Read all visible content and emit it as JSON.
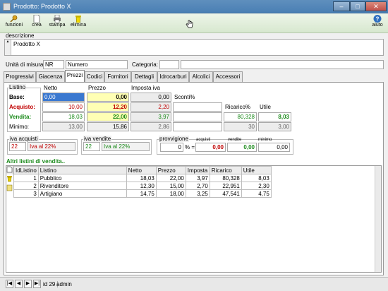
{
  "window": {
    "title": "Prodotto: Prodotto X",
    "btn_min": "–",
    "btn_max": "□",
    "btn_close": "✕"
  },
  "toolbar": {
    "funzioni": "funzioni",
    "crea": "crea",
    "stampa": "stampa",
    "elimina": "elimina",
    "aiuto": "aiuto"
  },
  "descrizione": {
    "label": "descrizione",
    "value": "Prodotto X",
    "scroll_up": "▲"
  },
  "misura": {
    "label": "Unità di misura:",
    "code": "NR",
    "name": "Numero"
  },
  "categoria": {
    "label": "Categoria:",
    "value": ""
  },
  "tabs": [
    "Progressivi",
    "Giacenza",
    "Prezzi",
    "Codici",
    "Fornitori",
    "Dettagli",
    "Idrocarburi",
    "Alcolici",
    "Accessori"
  ],
  "listino": {
    "h_listino": "Listino",
    "h_netto": "Netto",
    "h_prezzo": "Prezzo",
    "h_iva": "Imposta iva",
    "h_sconti": "Sconti%",
    "h_ricarico": "Ricarico%",
    "h_utile": "Utile",
    "base": {
      "label": "Base:",
      "netto": "0,00",
      "prezzo": "0,00",
      "iva": "0,00"
    },
    "acquisto": {
      "label": "Acquisto:",
      "netto": "10,00",
      "prezzo": "12,20",
      "iva": "2,20"
    },
    "vendita": {
      "label": "Vendita:",
      "netto": "18,03",
      "prezzo": "22,00",
      "iva": "3,97",
      "ricarico": "80,328",
      "utile": "8,03"
    },
    "minimo": {
      "label": "Minimo:",
      "netto": "13,00",
      "prezzo": "15,86",
      "iva": "2,86",
      "ricarico": "30",
      "utile": "3,00"
    }
  },
  "iva_acquisti": {
    "label": "iva acquisti",
    "code": "22",
    "desc": "Iva al 22%"
  },
  "iva_vendite": {
    "label": "iva vendite",
    "code": "22",
    "desc": "Iva al 22%"
  },
  "provvigione": {
    "label": "provvigione",
    "value": "0",
    "percent": "% =",
    "h_acquisti": "acquisti",
    "h_vendite": "vendite",
    "h_minimo": "minimo",
    "acquisti": "0,00",
    "vendite": "0,00",
    "minimo": "0,00"
  },
  "altri": {
    "title": "Altri listini di vendita..",
    "headers": [
      "IdListino",
      "Listino",
      "Netto",
      "Prezzo",
      "Imposta",
      "Ricarico",
      "Utile"
    ],
    "rows": [
      [
        "1",
        "Pubblico",
        "18,03",
        "22,00",
        "3,97",
        "80,328",
        "8,03"
      ],
      [
        "2",
        "Rivenditore",
        "12,30",
        "15,00",
        "2,70",
        "22,951",
        "2,30"
      ],
      [
        "3",
        "Artigiano",
        "14,75",
        "18,00",
        "3,25",
        "47,541",
        "4,75"
      ]
    ]
  },
  "status": {
    "first": "|◀",
    "prev": "◀",
    "next": "▶",
    "last": "▶|",
    "id": "id 29",
    "user": "admin"
  }
}
